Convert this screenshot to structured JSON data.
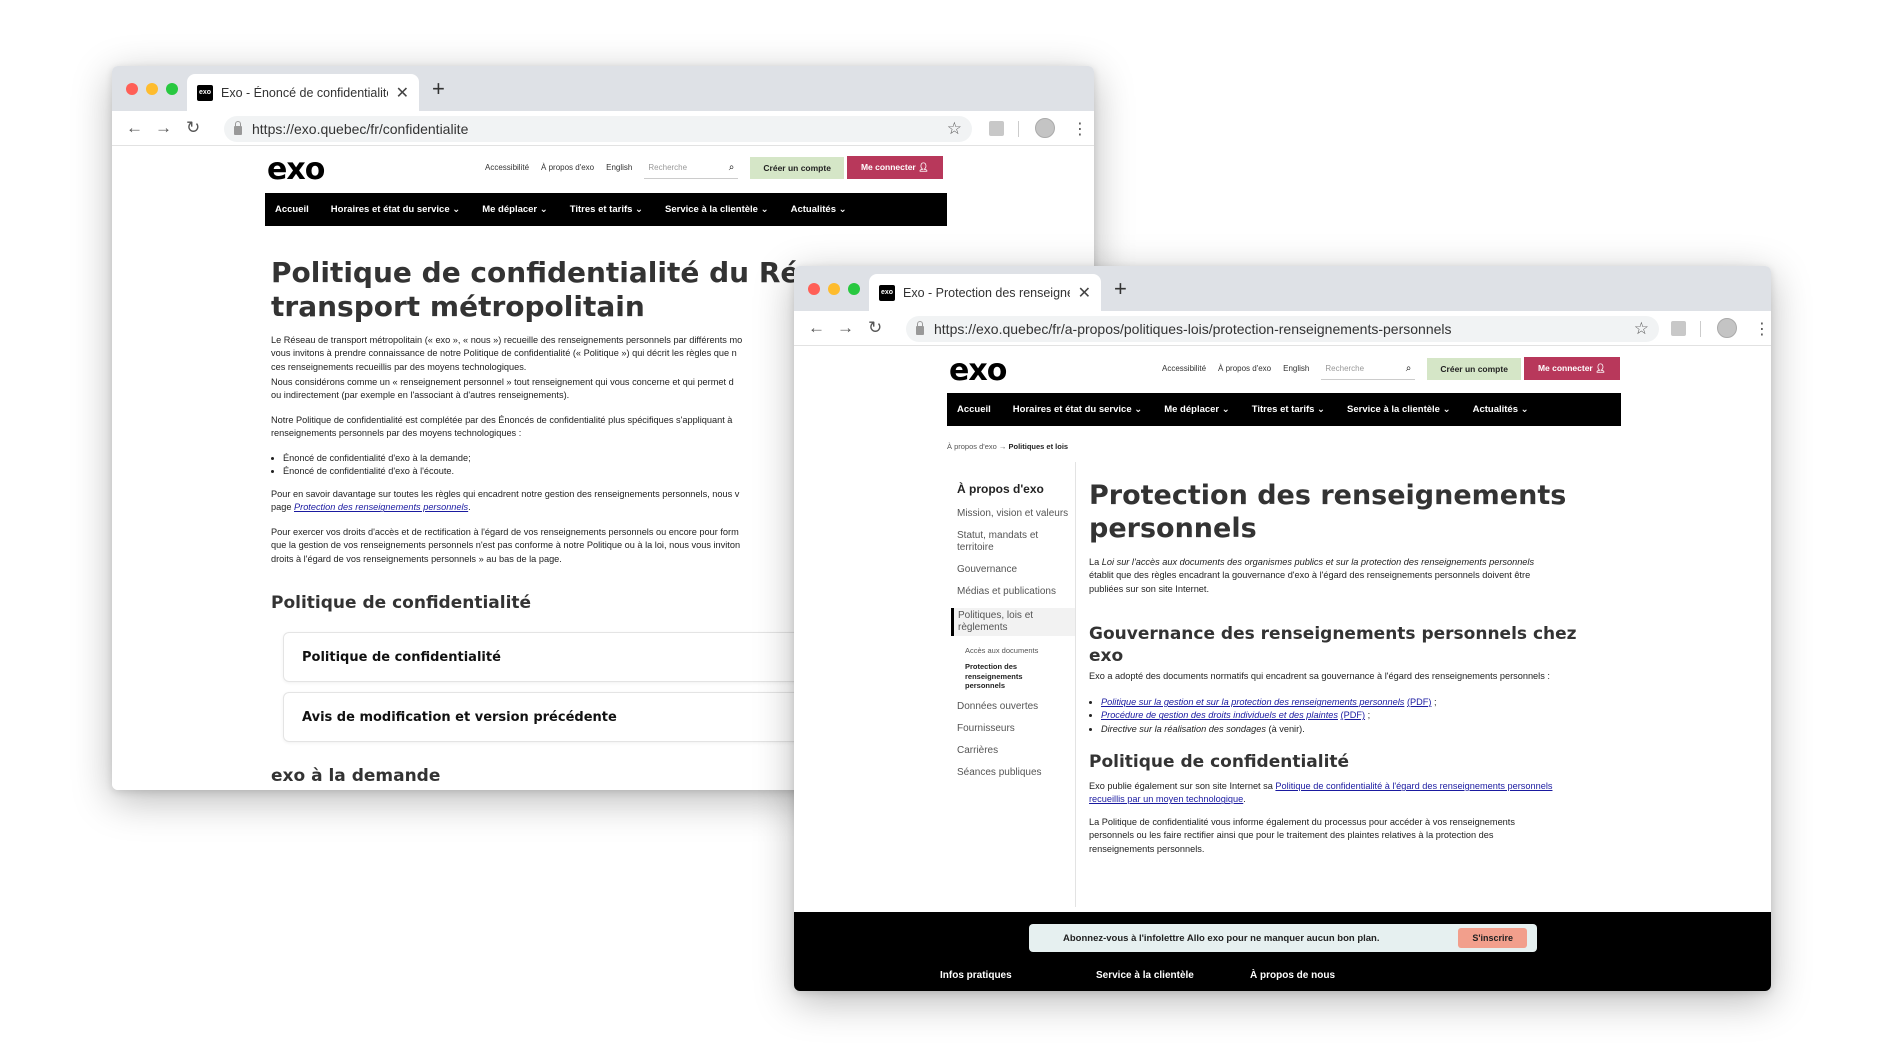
{
  "window1": {
    "tab_title": "Exo - Énoncé de confidentialité",
    "url": "https://exo.quebec/fr/confidentialite",
    "page": {
      "title_line1": "Politique de confidentialité du Résea",
      "title_line2": "transport métropolitain",
      "intro": [
        "Le Réseau de transport métropolitain (« exo », « nous ») recueille des renseignements personnels par différents mo",
        "vous invitons à prendre connaissance de notre Politique de confidentialité (« Politique ») qui décrit les règles que n",
        "ces renseignements recueillis par des moyens technologiques."
      ],
      "para2": [
        "Nous considérons comme un « renseignement personnel » tout renseignement qui vous concerne et qui permet d",
        "ou indirectement (par exemple en l'associant à d'autres renseignements)."
      ],
      "para3": [
        "Notre Politique de confidentialité est complétée par des Énoncés de confidentialité plus spécifiques s'appliquant à",
        "renseignements personnels par des moyens technologiques :"
      ],
      "bullets": [
        "Énoncé de confidentialité d'exo à la demande;",
        "Énoncé de confidentialité d'exo à l'écoute."
      ],
      "para4_line1": "Pour en savoir davantage sur toutes les règles qui encadrent notre gestion des renseignements personnels, nous v",
      "para4_prefix": "page ",
      "para4_link": "Protection des renseignements personnels",
      "para4_suffix": ".",
      "para5": [
        "Pour exercer vos droits d'accès et de rectification à l'égard de vos renseignements personnels ou encore pour form",
        "que la gestion de vos renseignements personnels n'est pas conforme à notre Politique ou à la loi, nous vous inviton",
        "droits à l'égard de vos renseignements personnels » au bas de la page."
      ],
      "section_title": "Politique de confidentialité",
      "accordion1": "Politique de confidentialité",
      "accordion2": "Avis de modification et version précédente",
      "section2_title": "exo à la demande"
    }
  },
  "window2": {
    "tab_title": "Exo - Protection des renseignem",
    "url": "https://exo.quebec/fr/a-propos/politiques-lois/protection-renseignements-personnels",
    "breadcrumb": {
      "parent": "À propos d'exo",
      "arrow": "→",
      "current": "Politiques et lois"
    },
    "sidebar": {
      "title": "À propos d'exo",
      "items": [
        "Mission, vision et valeurs",
        "Statut, mandats et territoire",
        "Gouvernance",
        "Médias et publications",
        "Politiques, lois et règlements",
        "Données ouvertes",
        "Fournisseurs",
        "Carrières",
        "Séances publiques"
      ],
      "subitems": [
        "Accès aux documents",
        "Protection des renseignements personnels"
      ]
    },
    "page": {
      "title_line1": "Protection des renseignements",
      "title_line2": "personnels",
      "intro_prefix": "La ",
      "intro_italic": "Loi sur l'accès aux documents des organismes publics et sur la protection des renseignements personnels",
      "intro_rest": [
        "établit que des règles encadrant la gouvernance d'exo à l'égard des renseignements personnels doivent être",
        "publiées sur son site Internet."
      ],
      "h2_gov_line1": "Gouvernance des renseignements personnels chez",
      "h2_gov_line2": "exo",
      "gov_text": "Exo a adopté des documents normatifs qui encadrent sa gouvernance à l'égard des renseignements personnels :",
      "gov_links": [
        "Politique sur la gestion et sur la protection des renseignements personnels",
        "Procédure de gestion des droits individuels et des plaintes"
      ],
      "pdf_label": "(PDF)",
      "gov_sep": ";",
      "gov_item3": "Directive sur la réalisation des sondages",
      "gov_item3_suffix": "(à venir).",
      "h2_conf": "Politique de confidentialité",
      "conf_prefix": "Exo publie également sur son site Internet sa ",
      "conf_link1": "Politique de confidentialité à l'égard des renseignements personnels",
      "conf_link2": "recueillis par un moyen technologique",
      "conf_suffix": ".",
      "conf_para2": [
        "La Politique de confidentialité vous informe également du processus pour accéder à vos renseignements",
        "personnels ou les faire rectifier ainsi que pour le traitement des plaintes relatives à la protection des",
        "renseignements personnels."
      ]
    },
    "footer": {
      "newsletter_text": "Abonnez-vous à l'infolettre Allo exo pour ne manquer aucun bon plan.",
      "newsletter_button": "S'inscrire",
      "columns": [
        "Infos pratiques",
        "Service à la clientèle",
        "À propos de nous"
      ]
    }
  },
  "site_header": {
    "logo": "exo",
    "utility_links": [
      "Accessibilité",
      "À propos d'exo",
      "English"
    ],
    "search_placeholder": "Recherche",
    "create_account": "Créer un compte",
    "login": "Me connecter",
    "nav": [
      "Accueil",
      "Horaires et état du service",
      "Me déplacer",
      "Titres et tarifs",
      "Service à la clientèle",
      "Actualités"
    ]
  },
  "colors": {
    "login_button": "#b8385b",
    "create_button": "#d5e6c7",
    "nav_background": "#000000",
    "link": "#1a1aa0",
    "newsletter_button": "#f29f8c"
  },
  "icons": {
    "back": "back-arrow-icon",
    "forward": "forward-arrow-icon",
    "reload": "reload-icon",
    "bookmark": "star-icon",
    "search": "search-icon",
    "user": "user-icon",
    "close": "close-icon"
  }
}
